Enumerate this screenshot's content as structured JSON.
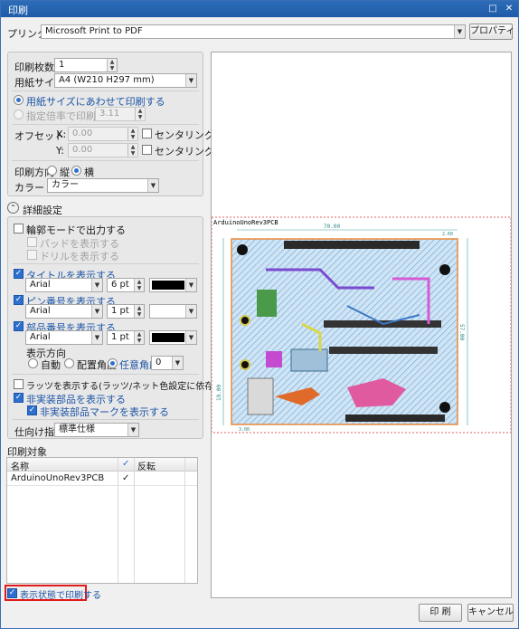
{
  "window": {
    "title": "印刷"
  },
  "printer": {
    "label": "プリンタ",
    "value": "Microsoft Print to PDF",
    "properties_button": "プロパティ"
  },
  "settings": {
    "copies_label": "印刷枚数",
    "copies_value": "1",
    "paper_size_label": "用紙サイズ",
    "paper_size_value": "A4 (W210 H297 mm)",
    "fit_to_paper_label": "用紙サイズにあわせて印刷する",
    "scale_label": "指定倍率で印刷する",
    "scale_value": "3.11",
    "offset_label": "オフセット",
    "offset_x_label": "X:",
    "offset_x_value": "0.00",
    "offset_y_label": "Y:",
    "offset_y_value": "0.00",
    "center_label_x": "センタリング",
    "center_label_y": "センタリング",
    "orientation_label": "印刷方向",
    "portrait_label": "縦",
    "landscape_label": "横",
    "color_label": "カラー",
    "color_value": "カラー"
  },
  "details": {
    "header": "詳細設定",
    "outline_mode": "輪郭モードで出力する",
    "show_pads": "パッドを表示する",
    "show_drills": "ドリルを表示する",
    "show_title": "タイトルを表示する",
    "title_font": "Arial",
    "title_size": "6 pt",
    "show_pin_numbers": "ピン番号を表示する",
    "pin_font": "Arial",
    "pin_size": "1 pt",
    "show_part_numbers": "部品番号を表示する",
    "part_font": "Arial",
    "part_size": "1 pt",
    "direction_label": "表示方向",
    "dir_auto": "自動",
    "dir_placement": "配置角度",
    "dir_arbitrary": "任意角度",
    "angle_value": "0",
    "show_ratsnest": "ラッツを表示する(ラッツ/ネット色設定に依存)",
    "show_unmounted": "非実装部品を表示する",
    "show_unmounted_mark": "非実装部品マークを表示する",
    "spec_label": "仕向け指定",
    "spec_value": "標準仕様"
  },
  "targets": {
    "label": "印刷対象",
    "col_name": "名称",
    "col_check": "✓",
    "col_flip": "反転",
    "rows": [
      {
        "name": "ArduinoUnoRev3PCB",
        "checked": "✓"
      }
    ]
  },
  "print_as_displayed": "表示状態で印刷する",
  "preview": {
    "board_title": "ArduinoUnoRev3PCB",
    "dim_width": "70.00",
    "dim_height": "57.00",
    "dim_left": "19.00",
    "dim_bottom_left": "3.00",
    "dim_top": "2.60"
  },
  "buttons": {
    "print": "印 刷",
    "cancel": "キャンセル"
  },
  "colors": {
    "accent": "#2c6fcf",
    "title_bar": "#2d6cb8",
    "highlight": "#e01b1b"
  }
}
